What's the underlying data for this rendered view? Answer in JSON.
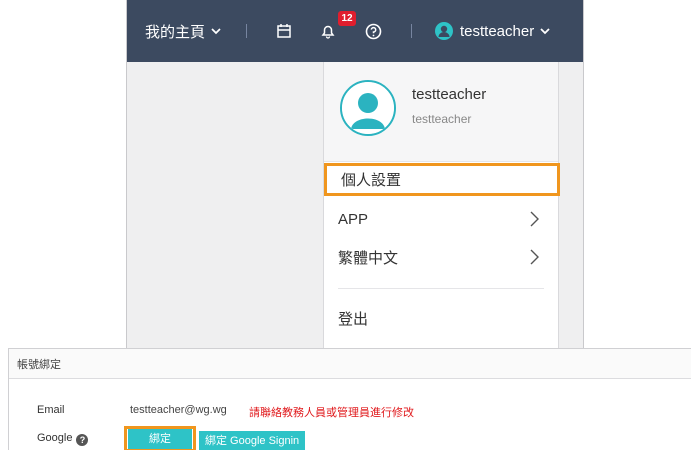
{
  "topbar": {
    "home_label": "我的主頁",
    "notification_count": "12",
    "username": "testteacher"
  },
  "dropdown": {
    "name": "testteacher",
    "sub": "testteacher",
    "items": [
      {
        "label": "個人設置"
      },
      {
        "label": "APP"
      },
      {
        "label": "繁體中文"
      },
      {
        "label": "登出"
      }
    ]
  },
  "settings": {
    "title": "帳號綁定",
    "email_label": "Email",
    "email_value": "testteacher@wg.wg",
    "email_warning": "請聯絡教務人員或管理員進行修改",
    "google_label": "Google",
    "bind_label": "綁定",
    "google_signin_label": "綁定 Google Signin"
  },
  "colors": {
    "topbar_bg": "#3c4a60",
    "highlight": "#f0961e",
    "accent": "#2ec3c7",
    "badge": "#e01e2e",
    "warning": "#e0191c"
  },
  "icons": {
    "home_chevron": "chevron-down-icon",
    "calendar": "calendar-icon",
    "bell": "bell-icon",
    "help": "help-circle-icon",
    "user": "user-avatar-icon"
  }
}
